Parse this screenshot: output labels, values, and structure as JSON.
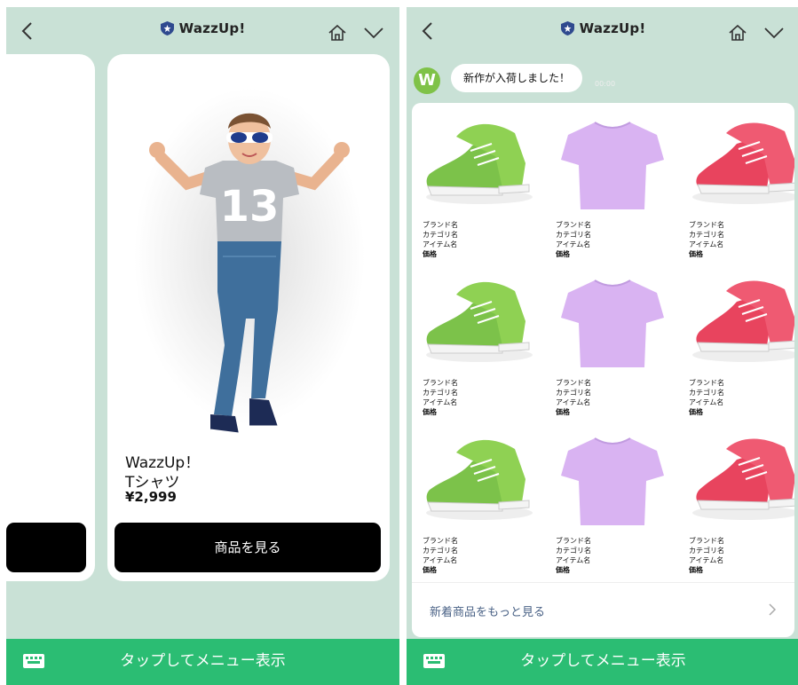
{
  "header": {
    "title": "WazzUp!"
  },
  "left_screen": {
    "product": {
      "brand": "WazzUp！",
      "item": "Tシャツ",
      "price": "¥2,999",
      "button_label": "商品を見る"
    }
  },
  "right_screen": {
    "message": {
      "avatar_letter": "W",
      "text": "新作が入荷しました！",
      "time": "00:00"
    },
    "products": [
      {
        "type": "green-sneakers",
        "lines": [
          "ブランド名",
          "カテゴリ名",
          "アイテム名",
          "価格"
        ]
      },
      {
        "type": "purple-tshirt",
        "lines": [
          "ブランド名",
          "カテゴリ名",
          "アイテム名",
          "価格"
        ]
      },
      {
        "type": "red-sneakers",
        "lines": [
          "ブランド名",
          "カテゴリ名",
          "アイテム名",
          "価格"
        ]
      },
      {
        "type": "green-sneakers",
        "lines": [
          "ブランド名",
          "カテゴリ名",
          "アイテム名",
          "価格"
        ]
      },
      {
        "type": "purple-tshirt",
        "lines": [
          "ブランド名",
          "カテゴリ名",
          "アイテム名",
          "価格"
        ]
      },
      {
        "type": "red-sneakers",
        "lines": [
          "ブランド名",
          "カテゴリ名",
          "アイテム名",
          "価格"
        ]
      },
      {
        "type": "green-sneakers",
        "lines": [
          "ブランド名",
          "カテゴリ名",
          "アイテム名",
          "価格"
        ]
      },
      {
        "type": "purple-tshirt",
        "lines": [
          "ブランド名",
          "カテゴリ名",
          "アイテム名",
          "価格"
        ]
      },
      {
        "type": "red-sneakers",
        "lines": [
          "ブランド名",
          "カテゴリ名",
          "アイテム名",
          "価格"
        ]
      }
    ],
    "more_link": "新着商品をもっと見る"
  },
  "menu_bar": {
    "label": "タップしてメニュー表示"
  },
  "colors": {
    "chat_bg": "#c9e1d6",
    "menu_bar": "#2bbd73",
    "button": "#000000",
    "link": "#4a6286"
  },
  "icons": [
    "back-icon",
    "shield-icon",
    "home-icon",
    "chevron-down-icon",
    "keyboard-icon",
    "chevron-right-icon"
  ]
}
